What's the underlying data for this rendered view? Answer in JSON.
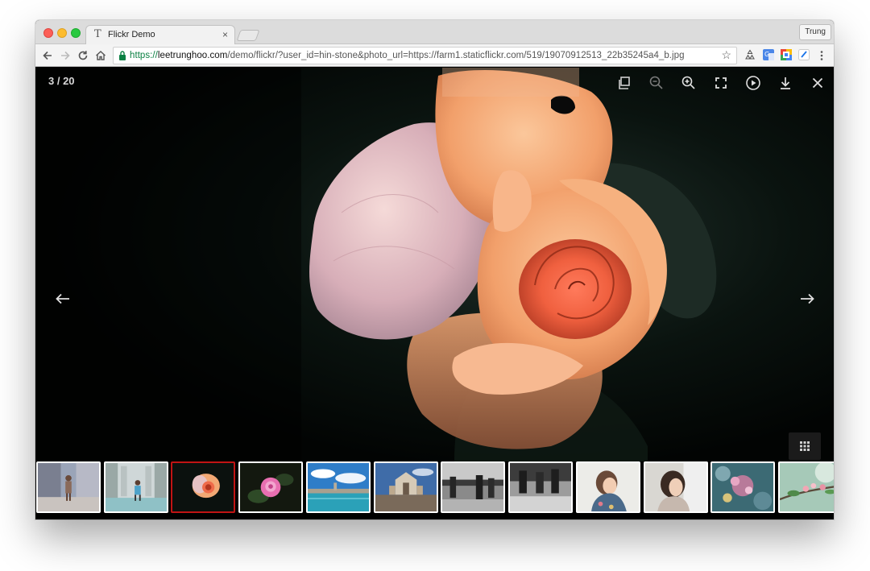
{
  "browser": {
    "tab_title": "Flickr Demo",
    "tab_icon": "T",
    "tab_close": "×",
    "profile_name": "Trung",
    "url_scheme": "https://",
    "url_host": "leetrunghoo.com",
    "url_path": "/demo/flickr/?user_id=hin-stone&photo_url=https://farm1.staticflickr.com/519/19070912513_22b35245a4_b.jpg"
  },
  "viewer": {
    "counter": "3 / 20",
    "toolbar_icons": [
      "copy-icon",
      "zoom-out-icon",
      "zoom-in-icon",
      "fullscreen-icon",
      "play-icon",
      "download-icon",
      "close-icon"
    ],
    "nav_icons": [
      "arrow-left-icon",
      "arrow-right-icon"
    ],
    "grid_icon": "grid-icon"
  },
  "filmstrip": {
    "thumbnails": [
      {
        "subject": "child-street"
      },
      {
        "subject": "child-corridor"
      },
      {
        "subject": "orange-rose",
        "active": true
      },
      {
        "subject": "pink-rose"
      },
      {
        "subject": "venice-lagoon"
      },
      {
        "subject": "church-square"
      },
      {
        "subject": "street-bw"
      },
      {
        "subject": "people-bw"
      },
      {
        "subject": "girl-portrait"
      },
      {
        "subject": "girl-hair"
      },
      {
        "subject": "flowers-bokeh"
      },
      {
        "subject": "blossom-branch"
      }
    ]
  },
  "colors": {
    "accent_active_thumb": "#c11414",
    "viewer_background": "#000000",
    "url_secure": "#0b8043"
  }
}
